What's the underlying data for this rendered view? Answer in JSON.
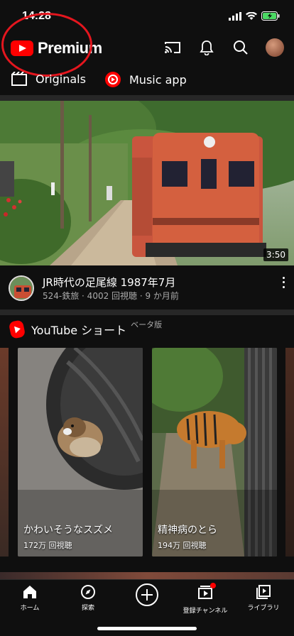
{
  "status_bar": {
    "time": "14:28"
  },
  "header": {
    "logo_text": "Premium"
  },
  "chips": [
    {
      "label": "Originals"
    },
    {
      "label": "Music app"
    }
  ],
  "video": {
    "duration": "3:50",
    "title": "JR時代の足尾線 1987年7月",
    "channel_meta": "524-鉄旅 · 4002 回視聴 · 9 か月前"
  },
  "shorts": {
    "title": "YouTube ショート",
    "beta": "ベータ版",
    "items": [
      {
        "caption": "かわいそうなスズメ",
        "views": "172万 回視聴"
      },
      {
        "caption": "精神病のとら",
        "views": "194万 回視聴"
      }
    ]
  },
  "bottom_nav": [
    {
      "label": "ホーム"
    },
    {
      "label": "探索"
    },
    {
      "label": ""
    },
    {
      "label": "登録チャンネル"
    },
    {
      "label": "ライブラリ"
    }
  ],
  "colors": {
    "brand": "#ff0000",
    "annotation": "#e4161e",
    "background": "#0f0f0f"
  },
  "icons": [
    "cast-icon",
    "bell-icon",
    "search-icon",
    "originals-icon",
    "music-app-icon",
    "shorts-icon",
    "home-icon",
    "explore-icon",
    "create-icon",
    "subscriptions-icon",
    "library-icon"
  ]
}
